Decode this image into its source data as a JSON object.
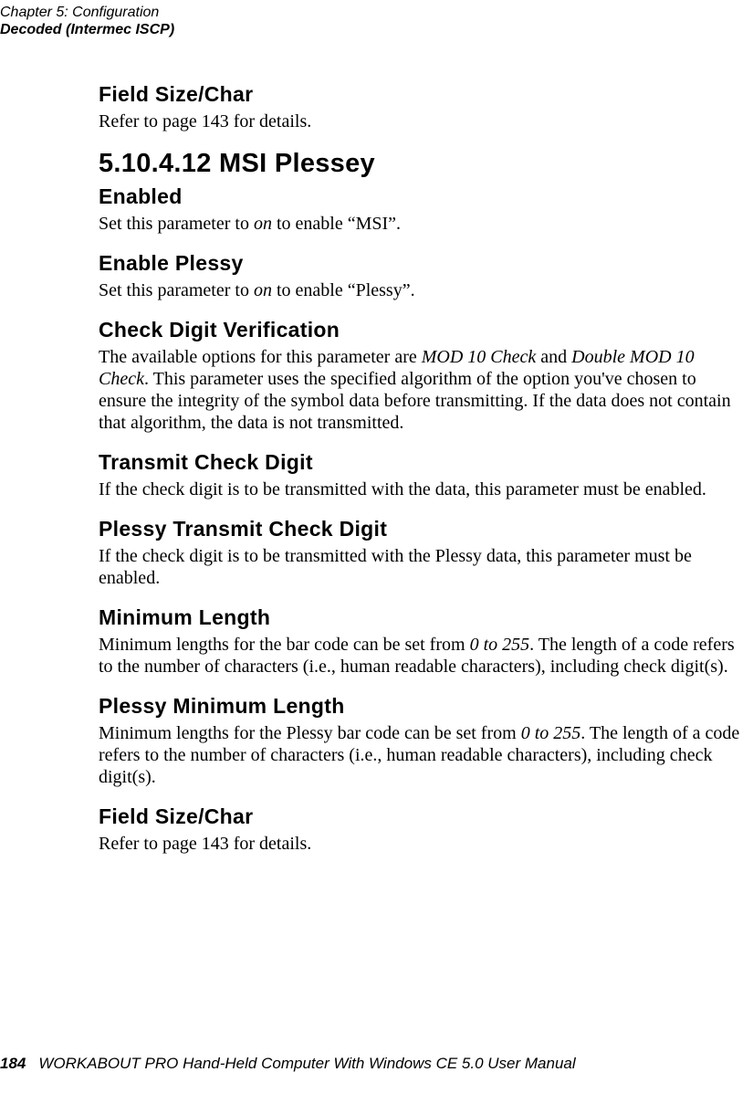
{
  "header": {
    "line1": "Chapter 5: Configuration",
    "line2": "Decoded (Intermec ISCP)"
  },
  "sections": {
    "field_size_char_1": {
      "title": "Field Size/Char",
      "body_a": "Refer to page 143 for details."
    },
    "msi_plessey": {
      "title": "5.10.4.12  MSI Plessey"
    },
    "enabled": {
      "title": "Enabled",
      "body_a": "Set this parameter to ",
      "em1": "on",
      "body_b": " to enable “MSI”."
    },
    "enable_plessy": {
      "title": "Enable Plessy",
      "body_a": "Set this parameter to ",
      "em1": "on",
      "body_b": " to enable “Plessy”."
    },
    "check_digit_verification": {
      "title": "Check Digit Verification",
      "body_a": "The available options for this parameter are ",
      "em1": "MOD 10 Check",
      "body_b": " and ",
      "em2": "Double MOD 10 Check",
      "body_c": ". This parameter uses the specified algorithm of the option you've chosen to ensure the integrity of the symbol data before transmitting. If the data does not contain that algorithm, the data is not transmitted."
    },
    "transmit_check_digit": {
      "title": "Transmit Check Digit",
      "body_a": "If the check digit is to be transmitted with the data, this parameter must be enabled."
    },
    "plessy_transmit_check_digit": {
      "title": "Plessy Transmit Check Digit",
      "body_a": "If the check digit is to be transmitted with the Plessy data, this parameter must be enabled."
    },
    "minimum_length": {
      "title": "Minimum Length",
      "body_a": "Minimum lengths for the bar code can be set from ",
      "em1": "0 to 255",
      "body_b": ". The length of a code refers to the number of characters (i.e., human readable characters), including check digit(s)."
    },
    "plessy_minimum_length": {
      "title": "Plessy Minimum Length",
      "body_a": "Minimum lengths for the Plessy bar code can be set from ",
      "em1": "0 to 255",
      "body_b": ". The length of a code refers to the number of characters (i.e., human readable characters), including check digit(s)."
    },
    "field_size_char_2": {
      "title": "Field Size/Char",
      "body_a": "Refer to page 143 for details."
    }
  },
  "footer": {
    "page": "184",
    "title": "WORKABOUT PRO Hand-Held Computer With Windows CE 5.0 User Manual"
  }
}
